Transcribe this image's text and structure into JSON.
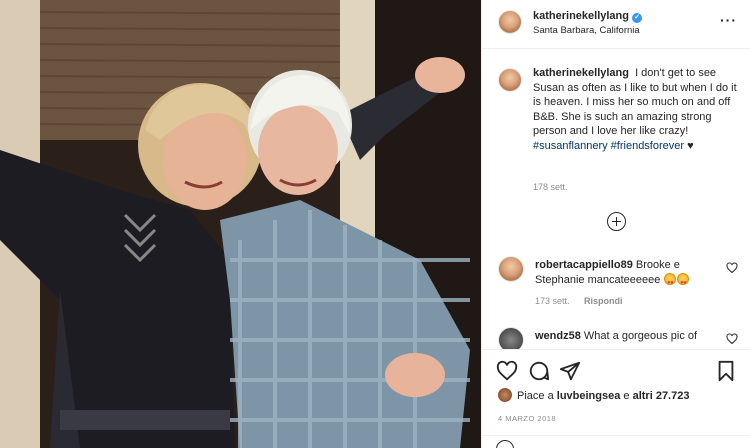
{
  "post": {
    "username": "katherinekellylang",
    "location": "Santa Barbara, California",
    "more_icon": "more-horizontal-icon"
  },
  "caption": {
    "username": "katherinekellylang",
    "text": "I don't get to see Susan as often as I like to but when I do it is heaven. I miss her so much on and off B&B. She is such an amazing strong person and I love her like crazy!",
    "hashtag1": "#susanflannery",
    "hashtag2": "#friendsforever",
    "heart": "♥",
    "time": "178 sett."
  },
  "comments": [
    {
      "username": "robertacappiello89",
      "text": "Brooke e Stephanie mancateeeeee",
      "time": "173 sett.",
      "reply": "Rispondi"
    },
    {
      "username": "wendz58",
      "text": "What a gorgeous pic of",
      "time": "",
      "reply": ""
    }
  ],
  "actions": {
    "like_icon": "heart-icon",
    "comment_icon": "comment-icon",
    "share_icon": "paper-plane-icon",
    "save_icon": "bookmark-icon"
  },
  "likes": {
    "prefix": "Piace a",
    "user": "luvbeingsea",
    "middle": "e",
    "others": "altri 27.723"
  },
  "date": "4 MARZO 2018"
}
